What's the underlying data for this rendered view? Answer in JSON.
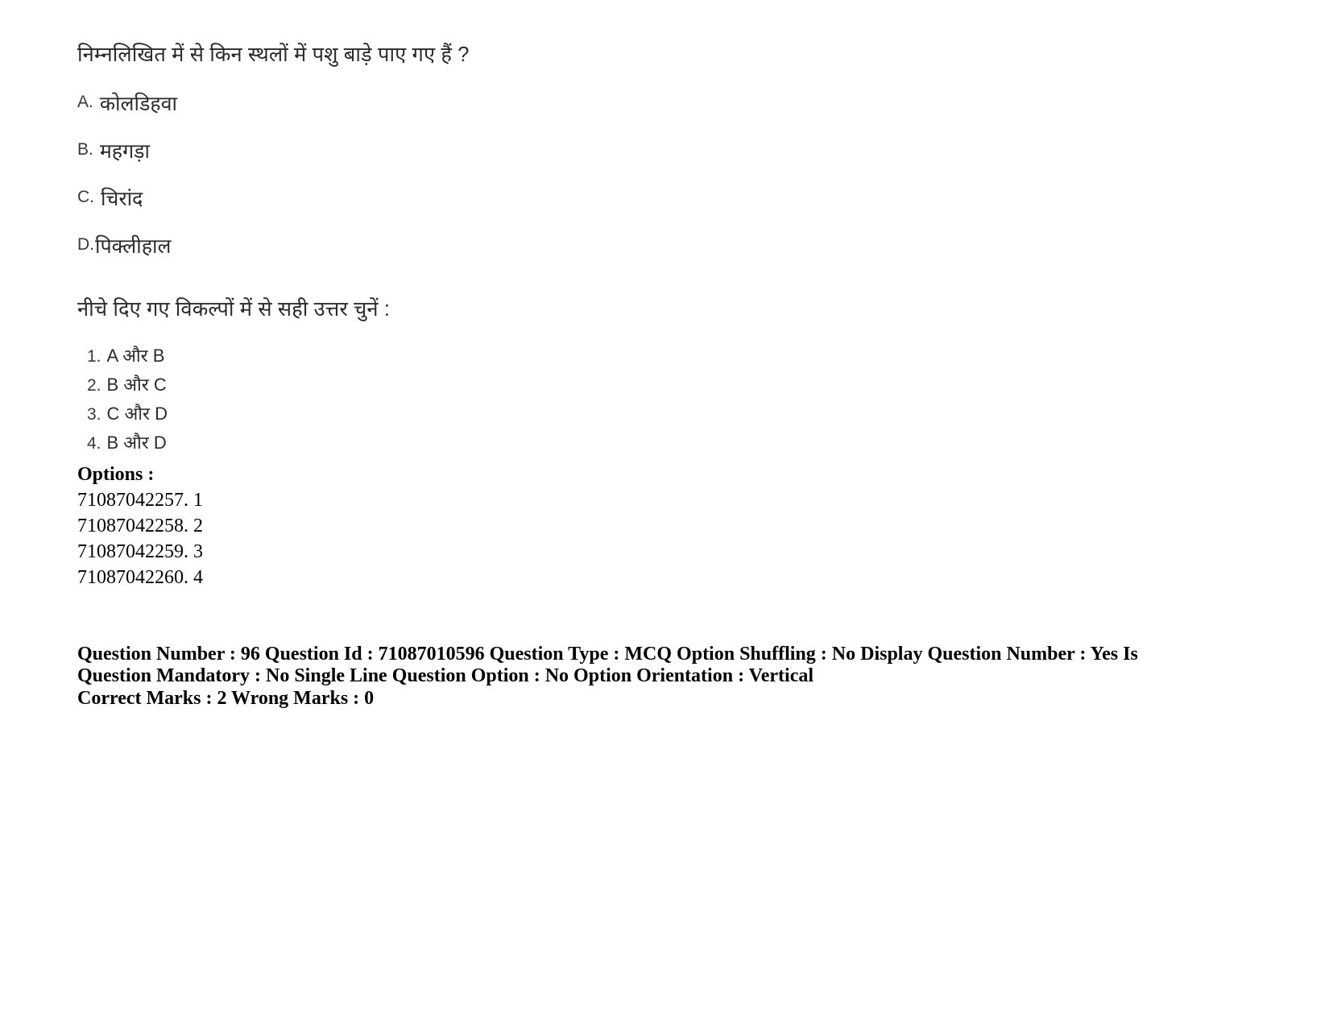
{
  "question": {
    "stem": "निम्नलिखित में से किन स्थलों में पशु बाड़े पाए गए हैं ?",
    "choices": [
      {
        "label": "A.",
        "text": "कोलडिहवा"
      },
      {
        "label": "B.",
        "text": "महगड़ा"
      },
      {
        "label": "C.",
        "text": "चिरांद"
      },
      {
        "label": "D.",
        "text": "पिक्लीहाल"
      }
    ],
    "instruction": "नीचे दिए गए विकल्पों में से सही उत्तर चुनें :",
    "answer_choices": [
      {
        "number": "1.",
        "value": "A और B"
      },
      {
        "number": "2.",
        "value": "B और C"
      },
      {
        "number": "3.",
        "value": "C और D"
      },
      {
        "number": "4.",
        "value": "B और D"
      }
    ]
  },
  "options_section": {
    "header": "Options :",
    "items": [
      "71087042257. 1",
      "71087042258. 2",
      "71087042259. 3",
      "71087042260. 4"
    ]
  },
  "metadata": {
    "line1": "Question Number : 96 Question Id : 71087010596 Question Type : MCQ Option Shuffling : No Display Question Number : Yes Is Question Mandatory : No Single Line Question Option : No Option Orientation : Vertical",
    "line2": "Correct Marks : 2 Wrong Marks : 0"
  }
}
